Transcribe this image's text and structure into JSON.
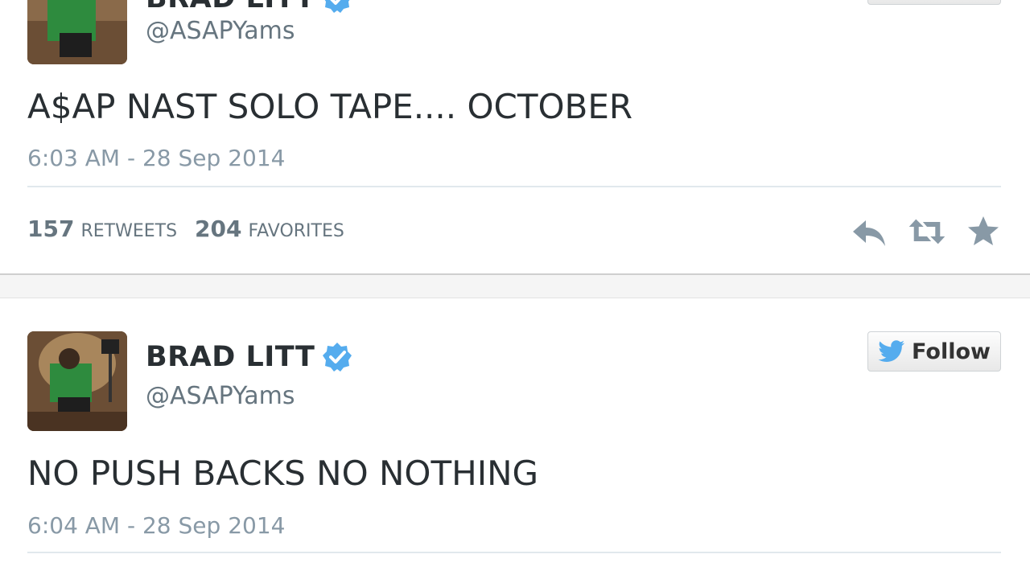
{
  "tweets": [
    {
      "display_name": "BRAD LITT",
      "handle": "@ASAPYams",
      "text": "A$AP NAST SOLO TAPE.... OCTOBER",
      "timestamp": "6:03 AM - 28 Sep 2014",
      "retweets_count": "157",
      "retweets_label": "RETWEETS",
      "favorites_count": "204",
      "favorites_label": "FAVORITES",
      "verified": true
    },
    {
      "display_name": "BRAD LITT",
      "handle": "@ASAPYams",
      "text": "NO PUSH BACKS NO NOTHING",
      "timestamp": "6:04 AM - 28 Sep 2014",
      "follow_label": "Follow",
      "verified": true
    }
  ],
  "icons": {
    "verified": "verified-badge-icon",
    "reply": "reply-icon",
    "retweet": "retweet-icon",
    "favorite": "star-icon",
    "bird": "twitter-bird-icon"
  },
  "colors": {
    "verified_blue": "#55acee",
    "bird_blue": "#55acee",
    "action_gray": "#8899a6",
    "text_dark": "#292f33",
    "text_muted": "#66757f"
  }
}
